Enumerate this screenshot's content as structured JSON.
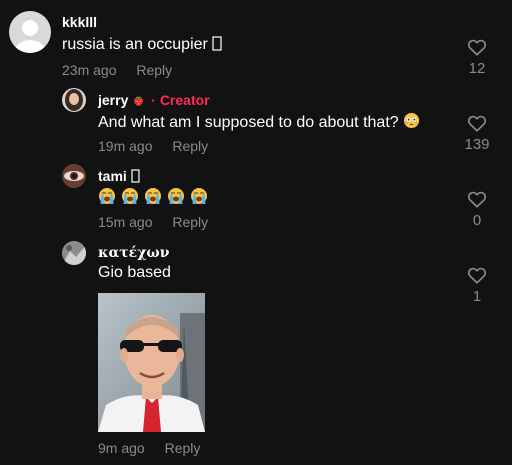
{
  "comments": [
    {
      "username": "kkklll",
      "text": "russia is an occupier",
      "trailing_emoji": "box-glyph",
      "time": "23m ago",
      "reply_label": "Reply",
      "likes": "12"
    },
    {
      "username": "jerry",
      "badge_icon": "strawberry-icon",
      "separator": "·",
      "creator_label": "Creator",
      "text": "And what am I supposed to do about that?",
      "trailing_emoji": "flushed-face-icon",
      "time": "19m ago",
      "reply_label": "Reply",
      "likes": "139"
    },
    {
      "username": "tami",
      "username_suffix": "box-glyph",
      "emoji_row": [
        "loudly-crying-face-icon",
        "loudly-crying-face-icon",
        "loudly-crying-face-icon",
        "loudly-crying-face-icon",
        "loudly-crying-face-icon"
      ],
      "time": "15m ago",
      "reply_label": "Reply",
      "likes": "0"
    },
    {
      "username": "κατέχων",
      "text": "Gio based",
      "attachment": "photo-of-man-in-suit-with-sunglasses",
      "time": "9m ago",
      "reply_label": "Reply",
      "likes": "1"
    }
  ],
  "colors": {
    "background": "#121212",
    "secondary_text": "#8a8a8a",
    "creator_accent": "#fe2c55"
  }
}
